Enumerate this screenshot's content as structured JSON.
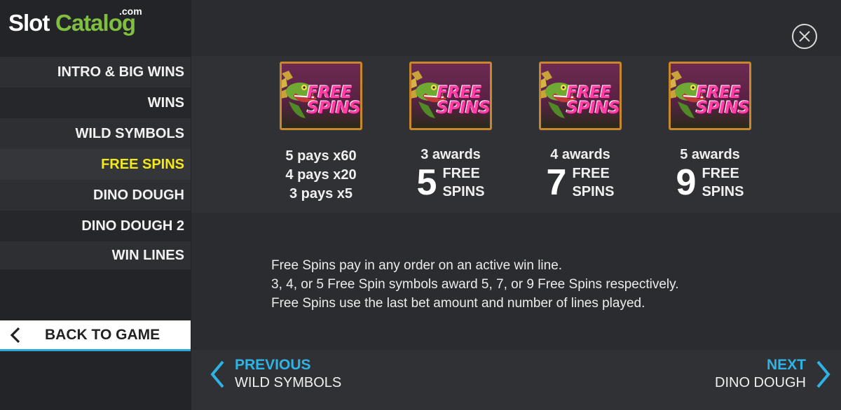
{
  "logo": {
    "slot": "Slot",
    "catalog": "Catalog",
    "com": ".com"
  },
  "menu": {
    "items": [
      {
        "label": "INTRO & BIG WINS"
      },
      {
        "label": "WINS"
      },
      {
        "label": "WILD SYMBOLS"
      },
      {
        "label": "FREE SPINS"
      },
      {
        "label": "DINO DOUGH"
      },
      {
        "label": "DINO DOUGH 2"
      },
      {
        "label": "WIN LINES"
      }
    ],
    "active": "FREE SPINS",
    "back_label": "BACK TO GAME"
  },
  "symbol": {
    "line1": "FREE",
    "line2": "SPINS"
  },
  "pays": [
    "5 pays x60",
    "4 pays x20",
    "3 pays x5"
  ],
  "awards": [
    {
      "title": "3 awards",
      "number": "5",
      "line1": "FREE",
      "line2": "SPINS"
    },
    {
      "title": "4 awards",
      "number": "7",
      "line1": "FREE",
      "line2": "SPINS"
    },
    {
      "title": "5 awards",
      "number": "9",
      "line1": "FREE",
      "line2": "SPINS"
    }
  ],
  "description": [
    "Free Spins pay in any order on an active win line.",
    "3, 4, or 5 Free Spin symbols award 5, 7, or 9 Free Spins respectively.",
    "Free Spins use the last bet amount and number of lines played."
  ],
  "nav": {
    "prev_label": "PREVIOUS",
    "prev_target": "WILD SYMBOLS",
    "next_label": "NEXT",
    "next_target": "DINO DOUGH"
  },
  "icons": {
    "close": "close-icon",
    "back": "chevron-left-icon",
    "prev": "chevron-left-icon",
    "next": "chevron-right-icon"
  },
  "colors": {
    "accent_yellow": "#f3e81b",
    "accent_blue": "#2fb3e6",
    "logo_green": "#7fbf3f"
  }
}
